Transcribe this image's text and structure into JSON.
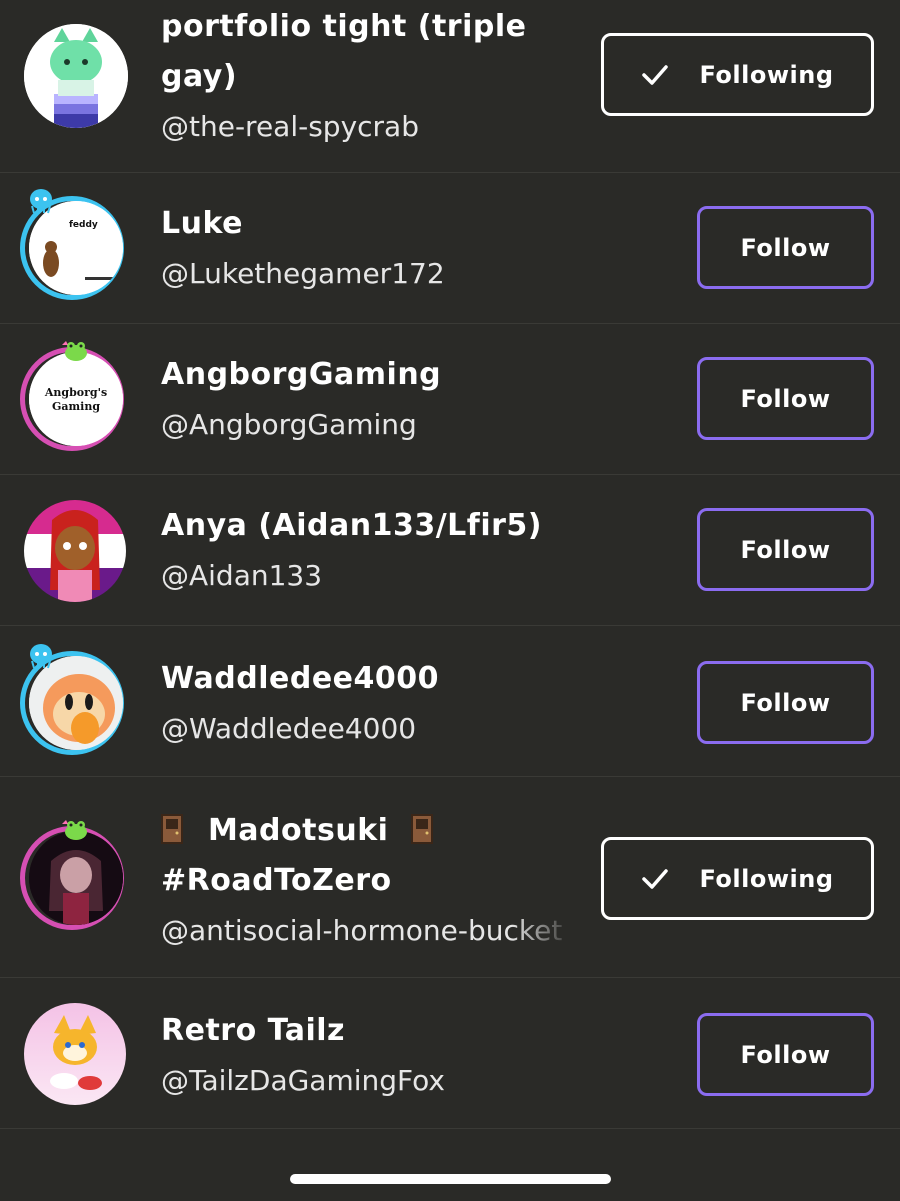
{
  "accent_color": "#8b6cf0",
  "users": [
    {
      "name": "portfolio tight (triple gay)",
      "handle": "@the-real-spycrab",
      "button": "Following",
      "following": true
    },
    {
      "name": "Luke",
      "handle": "@Lukethegamer172",
      "button": "Follow",
      "following": false,
      "avatar_text": "feddy"
    },
    {
      "name": "AngborgGaming",
      "handle": "@AngborgGaming",
      "button": "Follow",
      "following": false,
      "avatar_text": "Angborg's Gaming"
    },
    {
      "name": "Anya (Aidan133/Lfir5)",
      "handle": "@Aidan133",
      "button": "Follow",
      "following": false
    },
    {
      "name": "Waddledee4000",
      "handle": "@Waddledee4000",
      "button": "Follow",
      "following": false
    },
    {
      "name": "Madotsuki",
      "name_line2": "#RoadToZero",
      "handle": "@antisocial-hormone-bucket",
      "button": "Following",
      "following": true
    },
    {
      "name": "Retro Tailz",
      "handle": "@TailzDaGamingFox",
      "button": "Follow",
      "following": false
    }
  ]
}
